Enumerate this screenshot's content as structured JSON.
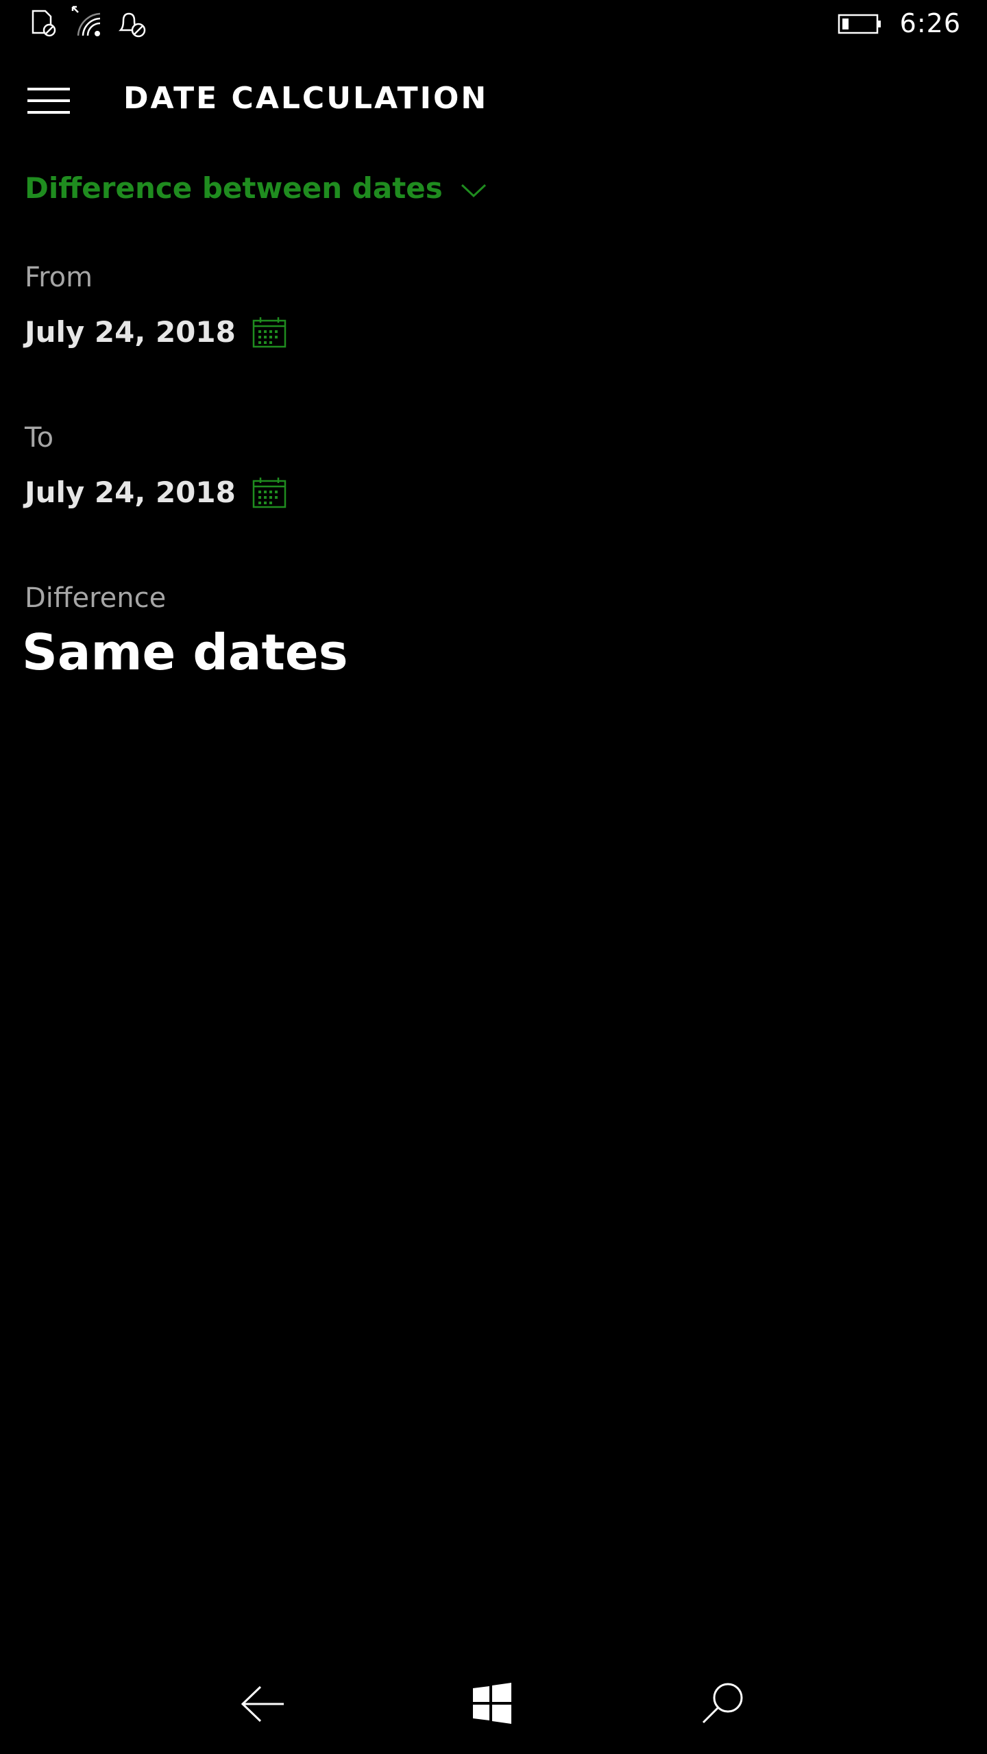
{
  "status_bar": {
    "time": "6:26",
    "icons": [
      "sim-missing-icon",
      "wifi-icon",
      "quiet-hours-icon",
      "battery-icon"
    ]
  },
  "header": {
    "menu_icon": "hamburger-icon",
    "title": "DATE CALCULATION"
  },
  "mode": {
    "label": "Difference between dates",
    "icon": "chevron-down-icon"
  },
  "from": {
    "label": "From",
    "date": "July 24, 2018",
    "icon": "calendar-icon"
  },
  "to": {
    "label": "To",
    "date": "July 24, 2018",
    "icon": "calendar-icon"
  },
  "difference": {
    "label": "Difference",
    "result": "Same dates"
  },
  "nav_bar": {
    "icons": [
      "back-arrow-icon",
      "windows-start-icon",
      "search-icon"
    ]
  },
  "colors": {
    "accent": "#1f8c1f",
    "background": "#000000",
    "label": "#a6a6a6"
  }
}
